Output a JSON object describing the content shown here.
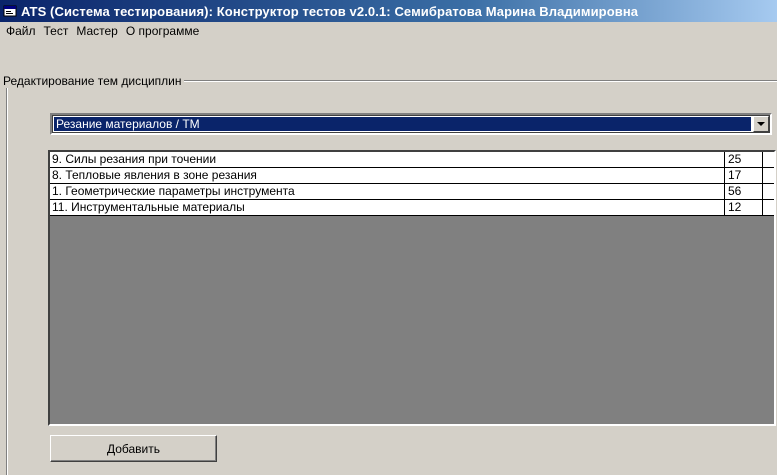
{
  "window": {
    "title": "ATS (Система тестирования): Конструктор тестов v2.0.1: Семибратова Марина Владимировна",
    "icon": "app-window-icon"
  },
  "menu": {
    "items": [
      {
        "label": "Файл"
      },
      {
        "label": "Тест"
      },
      {
        "label": "Мастер"
      },
      {
        "label": "О программе"
      }
    ]
  },
  "group": {
    "label": "Редактирование тем дисциплин"
  },
  "discipline_select": {
    "value": "Резание материалов / ТМ",
    "icon": "chevron-down-icon"
  },
  "topics": {
    "rows": [
      {
        "name": "9. Силы резания при точении",
        "count": "25"
      },
      {
        "name": "8. Тепловые явления в зоне резания",
        "count": "17"
      },
      {
        "name": "1. Геометрические параметры инструмента",
        "count": "56"
      },
      {
        "name": "11. Инструментальные материалы",
        "count": "12"
      }
    ]
  },
  "actions": {
    "add_label": "Добавить"
  },
  "colors": {
    "titlebar": "#0a246a",
    "face": "#d4d0c8",
    "selection": "#0a246a",
    "grid_background": "#808080"
  }
}
